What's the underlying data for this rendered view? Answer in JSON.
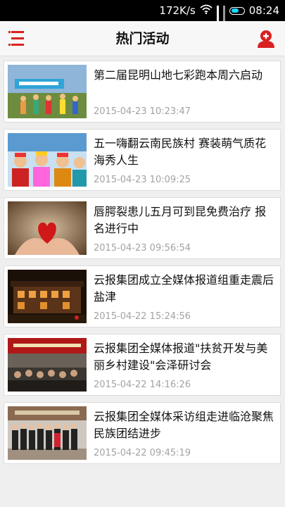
{
  "status_bar": {
    "speed": "172K/s",
    "time": "08:24"
  },
  "header": {
    "title": "热门活动"
  },
  "colors": {
    "accent": "#d92121"
  },
  "articles": [
    {
      "title": "第二届昆明山地七彩跑本周六启动",
      "time": "2015-04-23 10:23:47"
    },
    {
      "title": "五一嗨翻云南民族村 赛装萌气质花海秀人生",
      "time": "2015-04-23 10:09:25"
    },
    {
      "title": "唇腭裂患儿五月可到昆免费治疗 报名进行中",
      "time": "2015-04-23 09:56:54"
    },
    {
      "title": "云报集团成立全媒体报道组重走震后盐津",
      "time": "2015-04-22 15:24:56"
    },
    {
      "title": "云报集团全媒体报道\"扶贫开发与美丽乡村建设\"会泽研讨会",
      "time": "2015-04-22 14:16:26"
    },
    {
      "title": "云报集团全媒体采访组走进临沧聚焦民族团结进步",
      "time": "2015-04-22 09:45:19"
    }
  ]
}
